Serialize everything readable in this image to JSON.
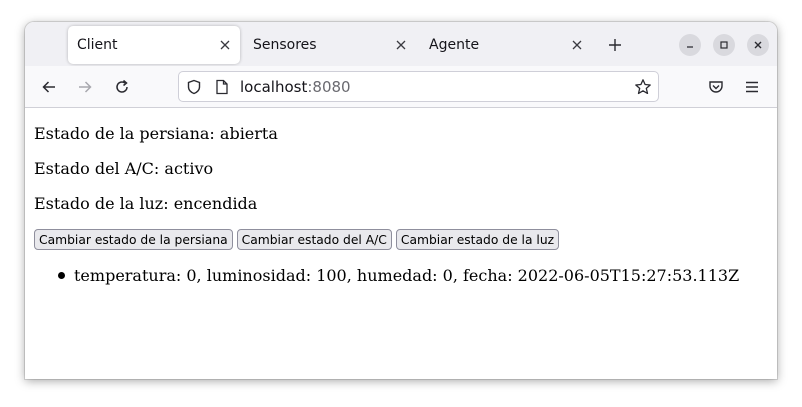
{
  "browser": {
    "tabs": [
      {
        "label": "Client",
        "active": true,
        "close_icon": "close-icon"
      },
      {
        "label": "Sensores",
        "active": false,
        "close_icon": "close-icon"
      },
      {
        "label": "Agente",
        "active": false,
        "close_icon": "close-icon"
      }
    ],
    "url": {
      "host": "localhost",
      "port": ":8080"
    },
    "icons": {
      "back": "back-arrow-icon",
      "forward": "forward-arrow-icon",
      "reload": "reload-icon",
      "shield": "shield-icon",
      "page": "page-icon",
      "bookmark": "star-icon",
      "pocket": "pocket-icon",
      "menu": "hamburger-menu-icon",
      "new_tab": "plus-icon",
      "minimize": "minimize-icon",
      "maximize": "maximize-icon",
      "close_window": "close-icon"
    }
  },
  "page": {
    "status_blind": "Estado de la persiana: abierta",
    "status_ac": "Estado del A/C: activo",
    "status_light": "Estado de la luz: encendida",
    "buttons": {
      "blind": "Cambiar estado de la persiana",
      "ac": "Cambiar estado del A/C",
      "light": "Cambiar estado de la luz"
    },
    "readings": [
      "temperatura: 0, luminosidad: 100, humedad: 0, fecha: 2022-06-05T15:27:53.113Z"
    ]
  }
}
